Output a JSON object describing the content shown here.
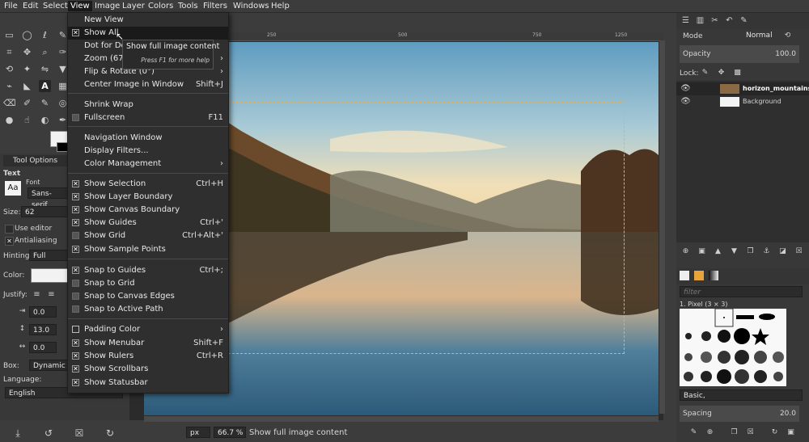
{
  "menubar": [
    "File",
    "Edit",
    "Select",
    "View",
    "Image",
    "Layer",
    "Colors",
    "Tools",
    "Filters",
    "Windows",
    "Help"
  ],
  "menu": {
    "items": [
      {
        "label": "New View",
        "check": "none",
        "key": "",
        "sub": false
      },
      {
        "label": "Show All",
        "check": "checked",
        "key": "",
        "sub": false,
        "highlighted": true
      },
      {
        "label": "Dot for Dot",
        "check": "none",
        "key": "",
        "sub": false
      },
      {
        "label": "Zoom (67%)",
        "check": "none",
        "key": "",
        "sub": true
      },
      {
        "label": "Flip & Rotate (0°)",
        "check": "none",
        "key": "",
        "sub": true
      },
      {
        "label": "Center Image in Window",
        "check": "none",
        "key": "Shift+J",
        "sub": false
      },
      {
        "label": "Shrink Wrap",
        "check": "none",
        "key": "",
        "sub": false
      },
      {
        "label": "Fullscreen",
        "check": "empty",
        "key": "F11",
        "sub": false
      },
      {
        "label": "Navigation Window",
        "check": "none",
        "key": "",
        "sub": false
      },
      {
        "label": "Display Filters...",
        "check": "none",
        "key": "",
        "sub": false
      },
      {
        "label": "Color Management",
        "check": "none",
        "key": "",
        "sub": true
      },
      {
        "label": "Show Selection",
        "check": "checked",
        "key": "Ctrl+H",
        "sub": false
      },
      {
        "label": "Show Layer Boundary",
        "check": "checked",
        "key": "",
        "sub": false
      },
      {
        "label": "Show Canvas Boundary",
        "check": "checked",
        "key": "",
        "sub": false
      },
      {
        "label": "Show Guides",
        "check": "checked",
        "key": "Ctrl+'",
        "sub": false
      },
      {
        "label": "Show Grid",
        "check": "empty",
        "key": "Ctrl+Alt+'",
        "sub": false
      },
      {
        "label": "Show Sample Points",
        "check": "checked",
        "key": "",
        "sub": false
      },
      {
        "label": "Snap to Guides",
        "check": "checked",
        "key": "Ctrl+;",
        "sub": false
      },
      {
        "label": "Snap to Grid",
        "check": "empty",
        "key": "",
        "sub": false
      },
      {
        "label": "Snap to Canvas Edges",
        "check": "empty",
        "key": "",
        "sub": false
      },
      {
        "label": "Snap to Active Path",
        "check": "empty",
        "key": "",
        "sub": false
      },
      {
        "label": "Padding Color",
        "check": "emptysq",
        "key": "",
        "sub": true
      },
      {
        "label": "Show Menubar",
        "check": "checked",
        "key": "Shift+F",
        "sub": false
      },
      {
        "label": "Show Rulers",
        "check": "checked",
        "key": "Ctrl+R",
        "sub": false
      },
      {
        "label": "Show Scrollbars",
        "check": "checked",
        "key": "",
        "sub": false
      },
      {
        "label": "Show Statusbar",
        "check": "checked",
        "key": "",
        "sub": false
      }
    ]
  },
  "tooltip": {
    "title": "Show full image content",
    "hint": "Press F1 for more help"
  },
  "tool_options": {
    "tab_label": "Tool Options",
    "section": "Text",
    "font_label": "Font",
    "font_preview": "Aa",
    "font_value": "Sans-serif",
    "size_label": "Size:",
    "size_value": "62",
    "use_editor": "Use editor",
    "antialiasing": "Antialiasing",
    "hinting_label": "Hinting:",
    "hinting_value": "Full",
    "color_label": "Color:",
    "justify_label": "Justify:",
    "indent_value": "0.0",
    "line_spacing_value": "13.0",
    "letter_spacing_value": "0.0",
    "box_label": "Box:",
    "box_value": "Dynamic",
    "language_label": "Language:",
    "language_value": "English"
  },
  "ruler": {
    "ticks": [
      "250",
      "500",
      "750",
      "1000",
      "1250"
    ]
  },
  "statusbar": {
    "unit": "px",
    "zoom": "66.7 %",
    "message": "Show full image content"
  },
  "layers": {
    "mode_label": "Mode",
    "mode_value": "Normal",
    "opacity_label": "Opacity",
    "opacity_value": "100.0",
    "lock_label": "Lock:",
    "items": [
      {
        "name": "horizon_mountains_r"
      },
      {
        "name": "Background"
      }
    ]
  },
  "brushes": {
    "filter_placeholder": "filter",
    "current_brush": "1. Pixel (3 × 3)",
    "preset": "Basic,",
    "spacing_label": "Spacing",
    "spacing_value": "20.0"
  },
  "colors": {
    "accent": "#1a1a1a",
    "menu_bg": "#2f2f2f",
    "selection": "#d6b36a"
  }
}
